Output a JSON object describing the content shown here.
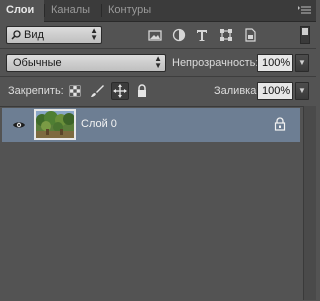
{
  "tabs": [
    {
      "label": "Слои",
      "active": true
    },
    {
      "label": "Каналы",
      "active": false
    },
    {
      "label": "Контуры",
      "active": false
    }
  ],
  "filter": {
    "value": "Вид"
  },
  "filter_icons": [
    "image-filter-icon",
    "adjustment-filter-icon",
    "type-filter-icon",
    "shape-filter-icon",
    "smart-object-filter-icon"
  ],
  "blend": {
    "mode": "Обычные"
  },
  "opacity": {
    "label": "Непрозрачность:",
    "value": "100%"
  },
  "lock": {
    "label": "Закрепить:"
  },
  "fill": {
    "label": "Заливка:",
    "value": "100%"
  },
  "layers": [
    {
      "name": "Слой 0",
      "visible": true,
      "selected": true,
      "locked": true
    }
  ],
  "colors": {
    "panel": "#535353",
    "selection": "#6d7e93",
    "tabbar": "#3b3b3b"
  }
}
